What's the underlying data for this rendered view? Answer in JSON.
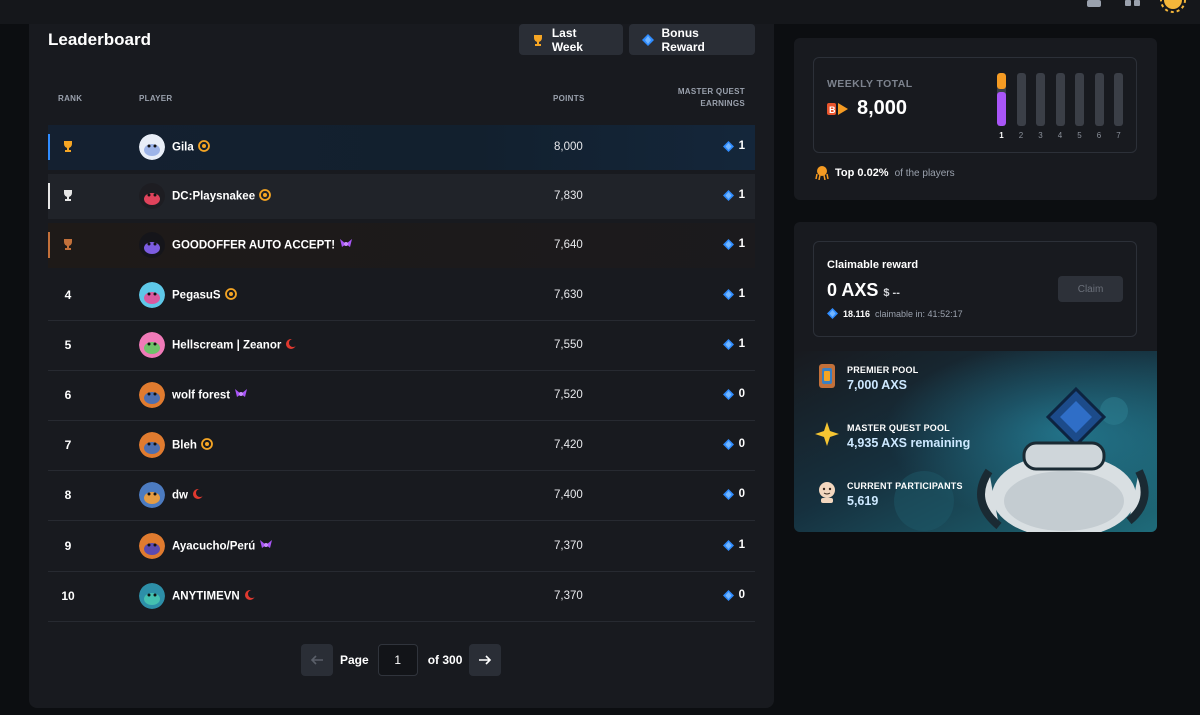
{
  "topbar": {
    "icons": [
      "cart-icon",
      "apps-grid-icon",
      "sun-avatar-icon"
    ]
  },
  "leaderboard": {
    "title": "Leaderboard",
    "buttons": {
      "period": "Last Week",
      "bonus": "Bonus Reward"
    },
    "columns": {
      "rank": "RANK",
      "player": "PLAYER",
      "points": "POINTS",
      "earnings_line1": "MASTER QUEST",
      "earnings_line2": "EARNINGS"
    },
    "rows": [
      {
        "rank": "",
        "rank_icon": "gold-trophy-icon",
        "name": "Gila",
        "badge": "orange-spiral-badge-icon",
        "points": "8,000",
        "earnings": "1"
      },
      {
        "rank": "",
        "rank_icon": "silver-trophy-icon",
        "name": "DC:Playsnakee",
        "badge": "orange-spiral-badge-icon",
        "points": "7,830",
        "earnings": "1"
      },
      {
        "rank": "",
        "rank_icon": "bronze-trophy-icon",
        "name": "GOODOFFER AUTO ACCEPT!",
        "badge": "purple-wings-badge-icon",
        "points": "7,640",
        "earnings": "1"
      },
      {
        "rank": "4",
        "name": "PegasuS",
        "badge": "orange-spiral-badge-icon",
        "points": "7,630",
        "earnings": "1"
      },
      {
        "rank": "5",
        "name": "Hellscream | Zeanor",
        "badge": "red-moon-badge-icon",
        "points": "7,550",
        "earnings": "1"
      },
      {
        "rank": "6",
        "name": "wolf forest",
        "badge": "purple-wings-badge-icon",
        "points": "7,520",
        "earnings": "0"
      },
      {
        "rank": "7",
        "name": "Bleh",
        "badge": "orange-spiral-badge-icon",
        "points": "7,420",
        "earnings": "0"
      },
      {
        "rank": "8",
        "name": "dw",
        "badge": "red-moon-badge-icon",
        "points": "7,400",
        "earnings": "0"
      },
      {
        "rank": "9",
        "name": "Ayacucho/Perú",
        "badge": "purple-wings-badge-icon",
        "points": "7,370",
        "earnings": "1"
      },
      {
        "rank": "10",
        "name": "ANYTIMEVN",
        "badge": "red-moon-badge-icon",
        "points": "7,370",
        "earnings": "0"
      }
    ],
    "pagination": {
      "page_label": "Page",
      "page_value": "1",
      "of_label": "of 300"
    }
  },
  "weekly": {
    "label": "WEEKLY TOTAL",
    "value": "8,000",
    "days": [
      "1",
      "2",
      "3",
      "4",
      "5",
      "6",
      "7"
    ],
    "active_day": 1,
    "top_percent": "Top 0.02%",
    "top_suffix": "of the players"
  },
  "reward": {
    "title": "Claimable reward",
    "value": "0 AXS",
    "usd": "$ --",
    "sub_amount": "18.116",
    "sub_text": "claimable in: 41:52:17",
    "claim_label": "Claim",
    "pools": [
      {
        "label": "PREMIER POOL",
        "value": "7,000  AXS",
        "icon": "trophy-pool-icon"
      },
      {
        "label": "MASTER QUEST POOL",
        "value": "4,935  AXS remaining",
        "icon": "gold-star-icon"
      },
      {
        "label": "CURRENT PARTICIPANTS",
        "value": "5,619",
        "icon": "participant-face-icon"
      }
    ]
  },
  "colors": {
    "gold": "#f5a524",
    "silver": "#e6e6e6",
    "bronze": "#c2703a",
    "accent_blue": "#2f8cff",
    "purple": "#a955f7"
  }
}
